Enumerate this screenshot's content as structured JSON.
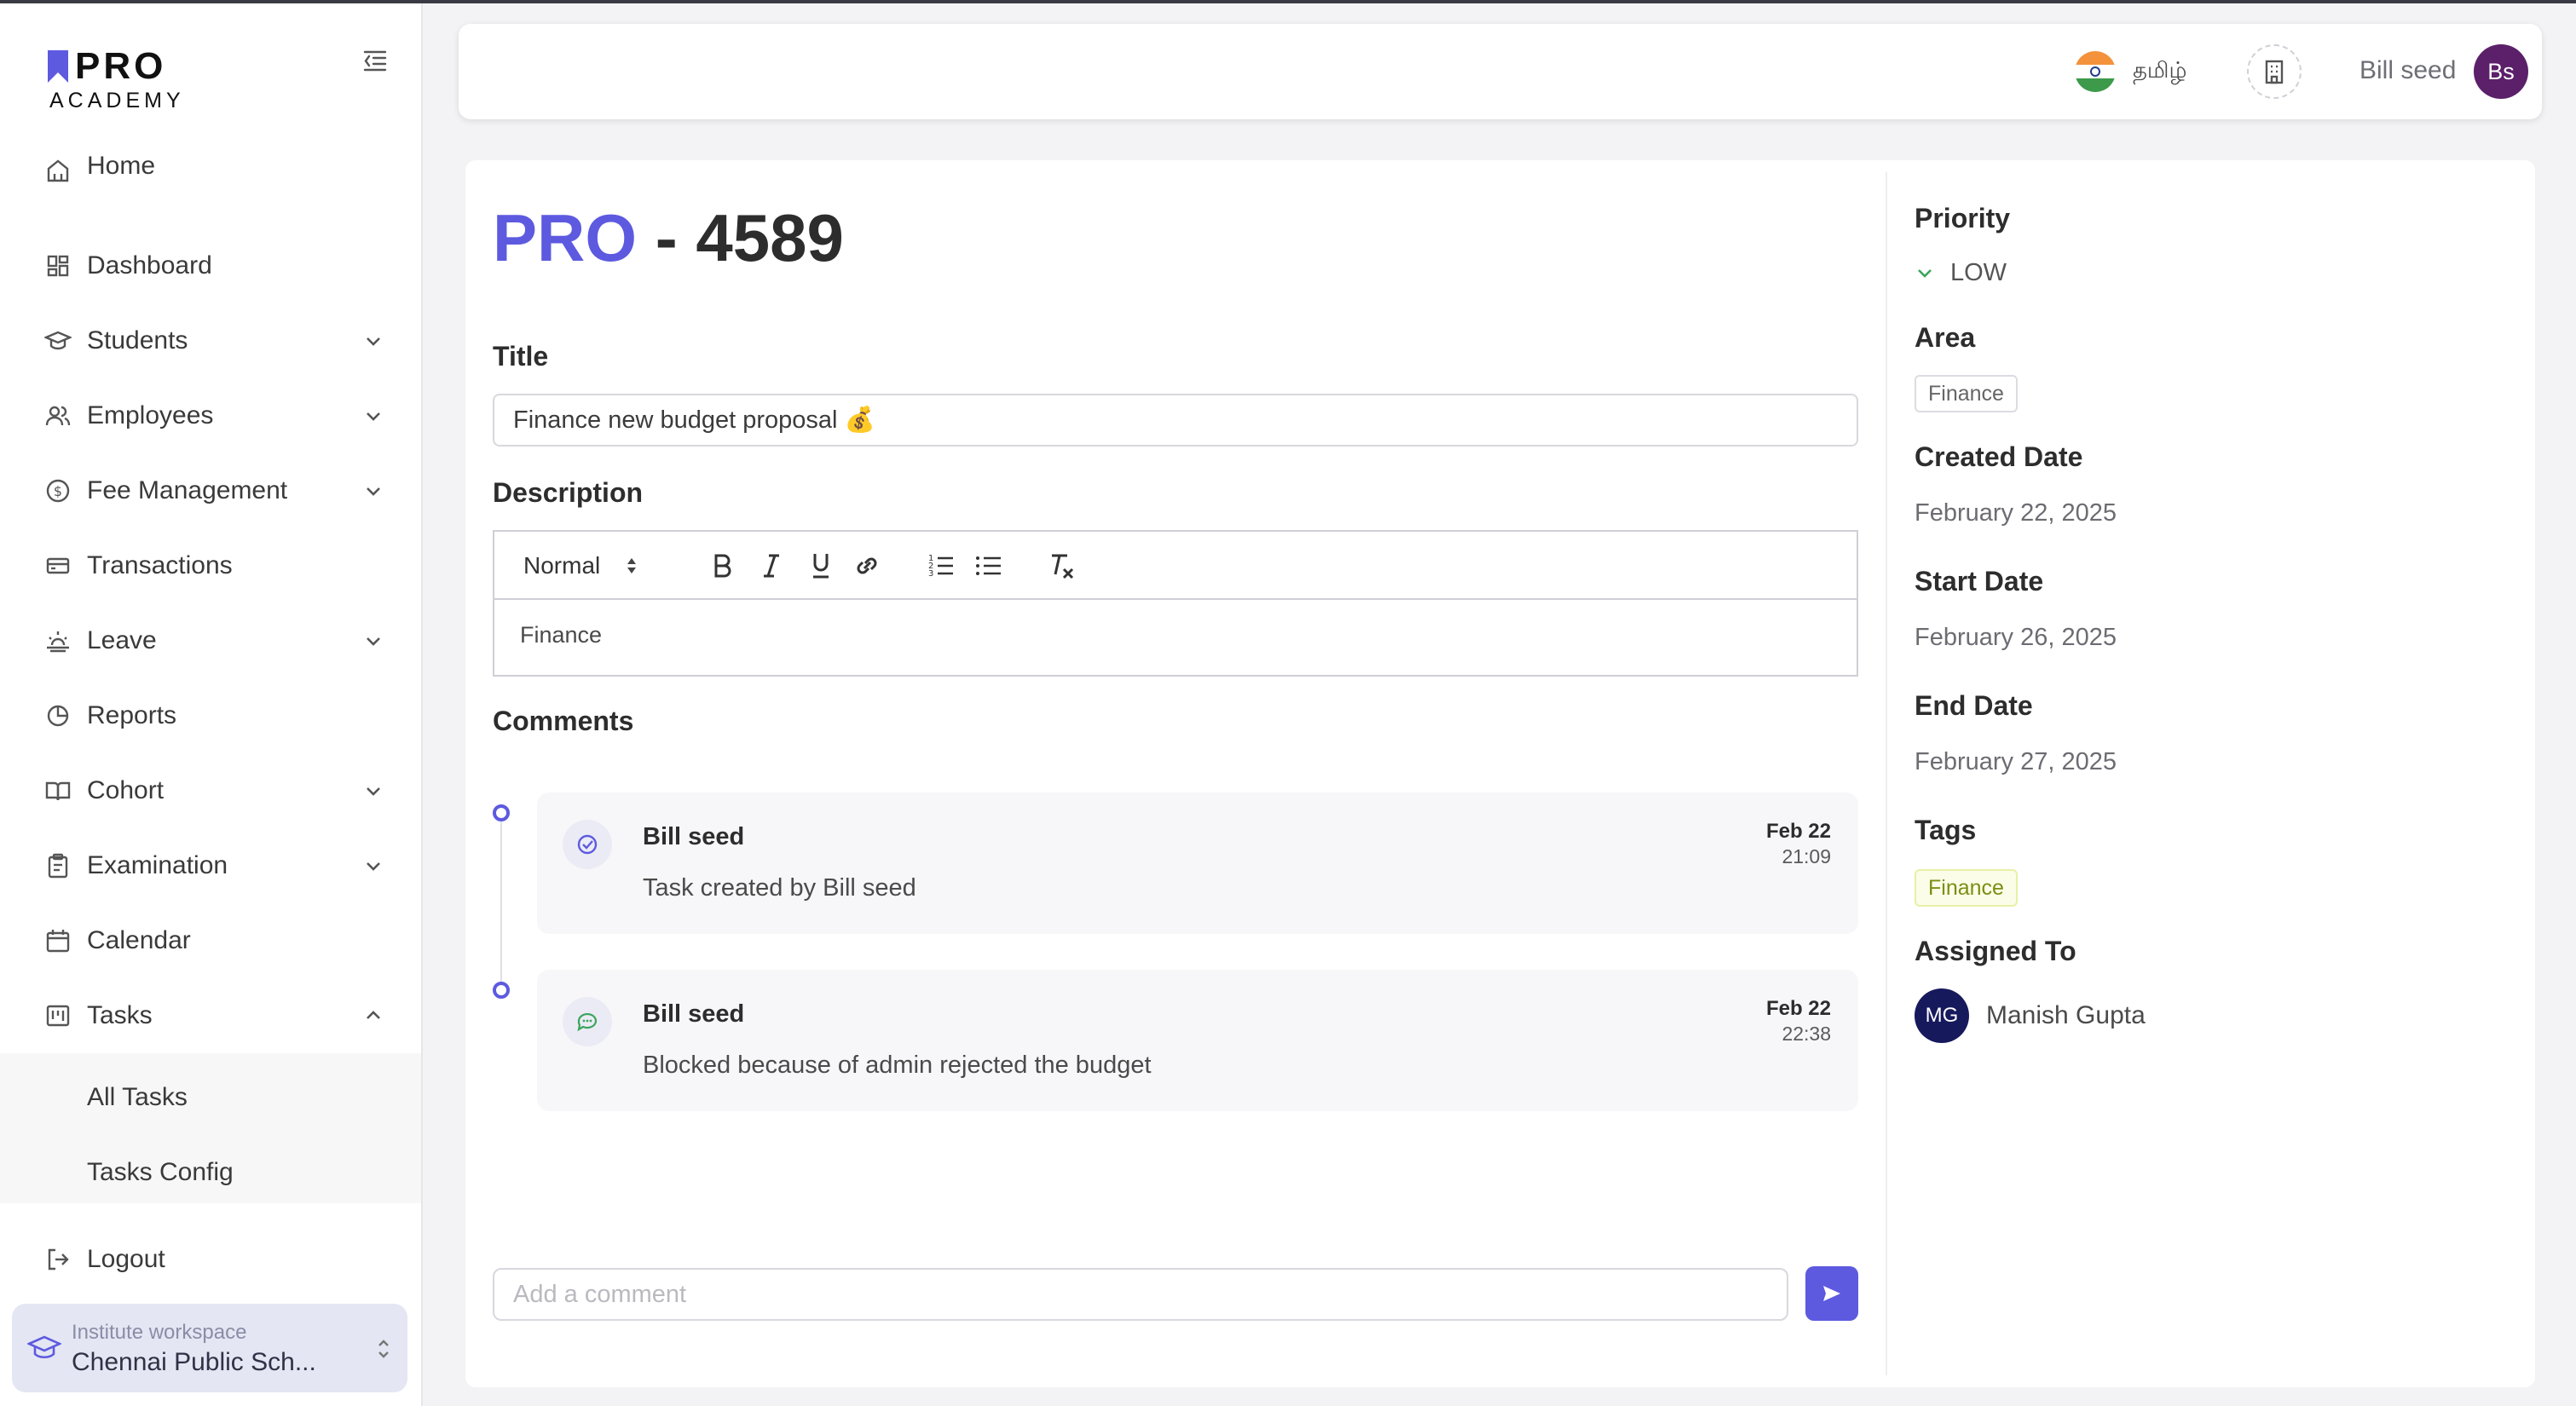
{
  "brand": {
    "name_top": "PRO",
    "name_bottom": "ACADEMY"
  },
  "sidebar": {
    "items": [
      {
        "label": "Home",
        "icon": "home-icon",
        "chevron": ""
      },
      {
        "label": "Dashboard",
        "icon": "dashboard-icon",
        "chevron": ""
      },
      {
        "label": "Students",
        "icon": "graduation-cap-icon",
        "chevron": "down"
      },
      {
        "label": "Employees",
        "icon": "users-icon",
        "chevron": "down"
      },
      {
        "label": "Fee Management",
        "icon": "dollar-circle-icon",
        "chevron": "down"
      },
      {
        "label": "Transactions",
        "icon": "card-icon",
        "chevron": ""
      },
      {
        "label": "Leave",
        "icon": "sunset-icon",
        "chevron": "down"
      },
      {
        "label": "Reports",
        "icon": "pie-chart-icon",
        "chevron": ""
      },
      {
        "label": "Cohort",
        "icon": "book-open-icon",
        "chevron": "down"
      },
      {
        "label": "Examination",
        "icon": "clipboard-icon",
        "chevron": "down"
      },
      {
        "label": "Calendar",
        "icon": "calendar-icon",
        "chevron": ""
      },
      {
        "label": "Tasks",
        "icon": "kanban-icon",
        "chevron": "up"
      }
    ],
    "sub_items": [
      {
        "label": "All Tasks"
      },
      {
        "label": "Tasks Config"
      }
    ],
    "logout_label": "Logout",
    "workspace": {
      "caption": "Institute workspace",
      "name": "Chennai Public Sch..."
    }
  },
  "header": {
    "language_label": "தமிழ்",
    "user_name": "Bill seed",
    "user_initials": "Bs"
  },
  "task": {
    "id_prefix": "PRO",
    "id_suffix": " - 4589",
    "title_label": "Title",
    "title_value": "Finance new budget proposal 💰",
    "description_label": "Description",
    "editor_format": "Normal",
    "description_value": "Finance",
    "comments_label": "Comments",
    "comments": [
      {
        "author": "Bill seed",
        "text": "Task created by Bill seed",
        "date": "Feb 22",
        "time": "21:09",
        "icon": "check-circle-icon"
      },
      {
        "author": "Bill seed",
        "text": "Blocked because of admin rejected the budget",
        "date": "Feb 22",
        "time": "22:38",
        "icon": "chat-bubble-icon"
      }
    ],
    "comment_placeholder": "Add a comment"
  },
  "meta": {
    "priority_label": "Priority",
    "priority_value": "LOW",
    "area_label": "Area",
    "area_value": "Finance",
    "created_label": "Created Date",
    "created_value": "February 22, 2025",
    "start_label": "Start Date",
    "start_value": "February 26, 2025",
    "end_label": "End Date",
    "end_value": "February 27, 2025",
    "tags_label": "Tags",
    "tags": [
      "Finance"
    ],
    "assigned_label": "Assigned To",
    "assignee_initials": "MG",
    "assignee_name": "Manish Gupta"
  },
  "colors": {
    "accent": "#5d5ae0",
    "avatar_user": "#5b2069",
    "avatar_assignee": "#16195c",
    "priority_low": "#3aa55d"
  }
}
